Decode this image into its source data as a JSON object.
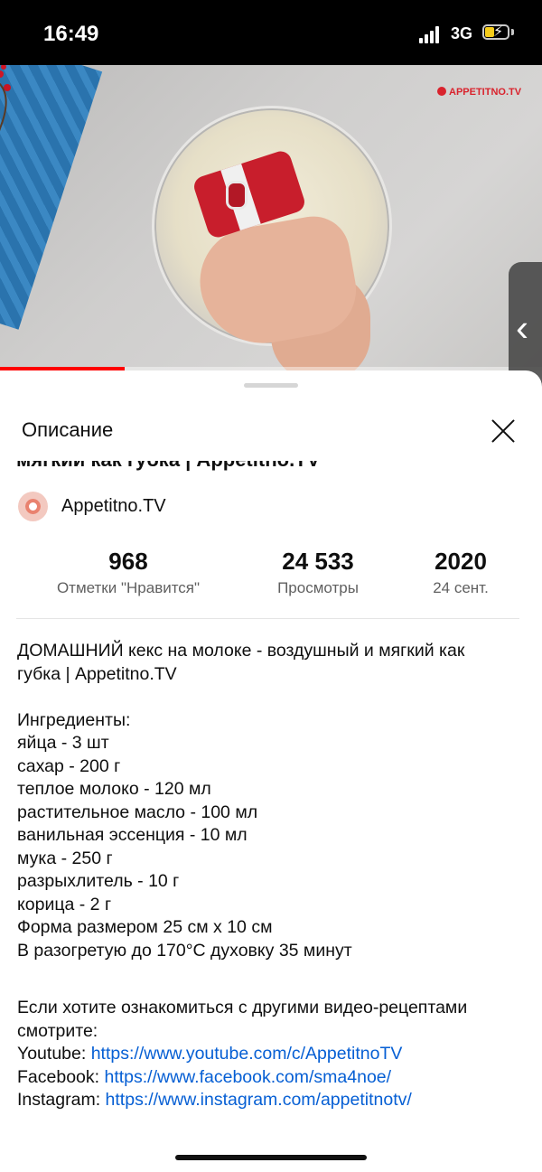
{
  "status_bar": {
    "time": "16:49",
    "network": "3G",
    "battery_level": 0.4,
    "battery_charging": true
  },
  "video": {
    "watermark": "APPETITNO.TV",
    "progress": 0.23
  },
  "sheet": {
    "title": "Описание",
    "video_title": "мягкий как губка | Appetitno.TV",
    "channel": {
      "name": "Appetitno.TV"
    },
    "stats": [
      {
        "value": "968",
        "label": "Отметки \"Нравится\""
      },
      {
        "value": "24 533",
        "label": "Просмотры"
      },
      {
        "value": "2020",
        "label": "24 сент."
      }
    ],
    "description": {
      "title_lines": [
        "ДОМАШНИЙ кекс на молоке - воздушный и мягкий как",
        "губка | Appetitno.TV"
      ],
      "ingredients_header": "Ингредиенты:",
      "ingredients": [
        "яйца - 3 шт",
        "сахар - 200 г",
        "теплое молоко - 120 мл",
        "растительное масло - 100 мл",
        "ванильная эссенция - 10 мл",
        "мука - 250 г",
        "разрыхлитель - 10 г",
        "корица - 2 г",
        "Форма размером 25 см х 10 см",
        "В разогретую до 170°С духовку 35 минут"
      ],
      "more_lines": [
        "Если хотите ознакомиться с другими видео-рецептами",
        "смотрите:"
      ],
      "links": [
        {
          "label": "Youtube:",
          "url": "https://www.youtube.com/c/AppetitnoTV"
        },
        {
          "label": "Facebook:",
          "url": "https://www.facebook.com/sma4noe/"
        },
        {
          "label": "Instagram:",
          "url": "https://www.instagram.com/appetitnotv/"
        }
      ]
    }
  },
  "colors": {
    "accent_red": "#ff0000",
    "link": "#065fd4",
    "secondary_text": "#606060"
  }
}
